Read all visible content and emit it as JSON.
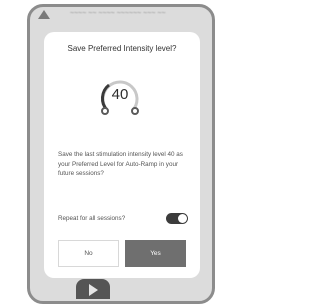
{
  "header": {
    "home_icon": "home-icon",
    "blurred_text": "~~~~ ~~ ~~~~ ~~~~~~ ~~~ ~~"
  },
  "dialog": {
    "title": "Save Preferred Intensity level?",
    "intensity_value": "40",
    "message": "Save the last stimulation intensity level 40 as your Preferred Level for Auto-Ramp in your future sessions?",
    "repeat_label": "Repeat for all sessions?",
    "repeat_on": true,
    "no_label": "No",
    "yes_label": "Yes"
  },
  "colors": {
    "overlay": "#dcdcdc",
    "accent": "#6f6f6f",
    "toggle": "#3c3c3c"
  },
  "bottom": {
    "play_icon": "play-icon"
  }
}
